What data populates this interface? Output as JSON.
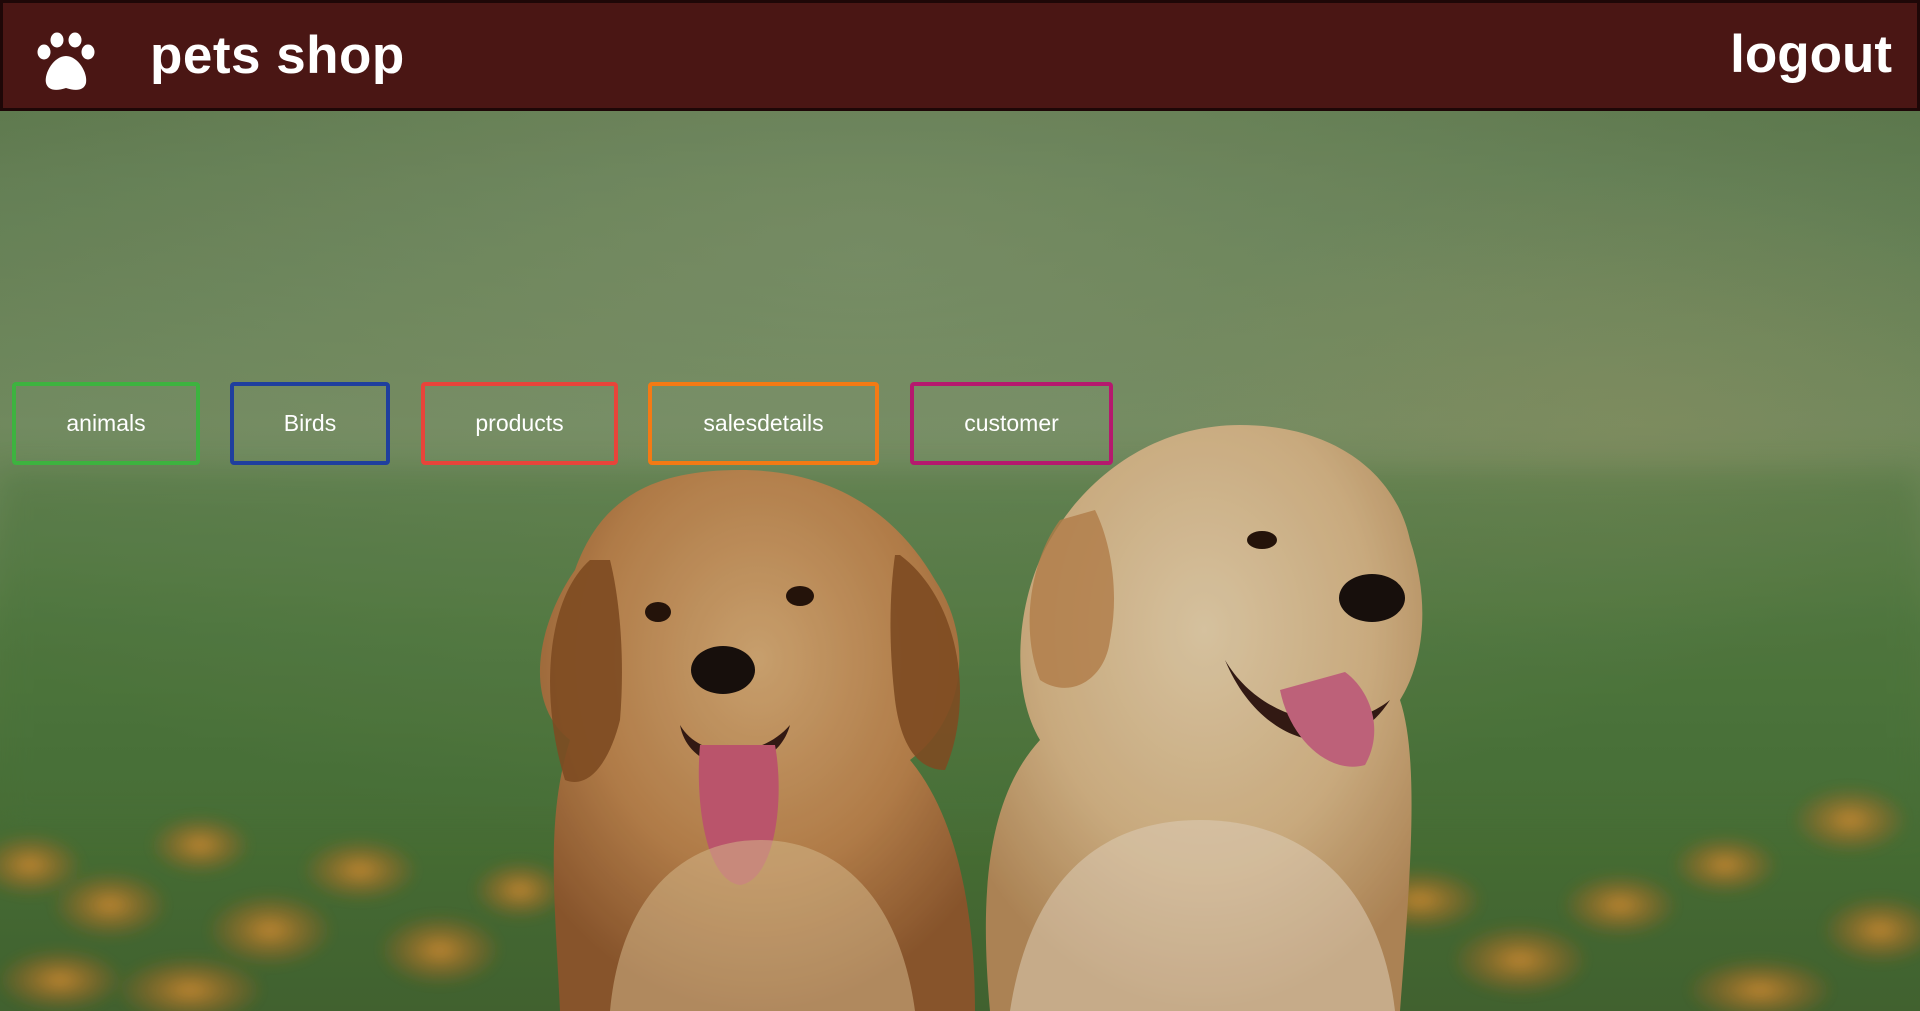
{
  "header": {
    "brand": "pets shop",
    "logo_icon": "paw-icon",
    "logout_label": "logout",
    "background_color": "#4a1614",
    "border_color": "#1e0707"
  },
  "nav": {
    "buttons": [
      {
        "label": "animals",
        "border_color": "#3db33f"
      },
      {
        "label": "Birds",
        "border_color": "#1f3f9e"
      },
      {
        "label": "products",
        "border_color": "#e8443a"
      },
      {
        "label": "salesdetails",
        "border_color": "#f47a14"
      },
      {
        "label": "customer",
        "border_color": "#b5196e"
      }
    ]
  },
  "hero": {
    "image": "two golden retriever puppies in a grassy field with orange flowers"
  }
}
